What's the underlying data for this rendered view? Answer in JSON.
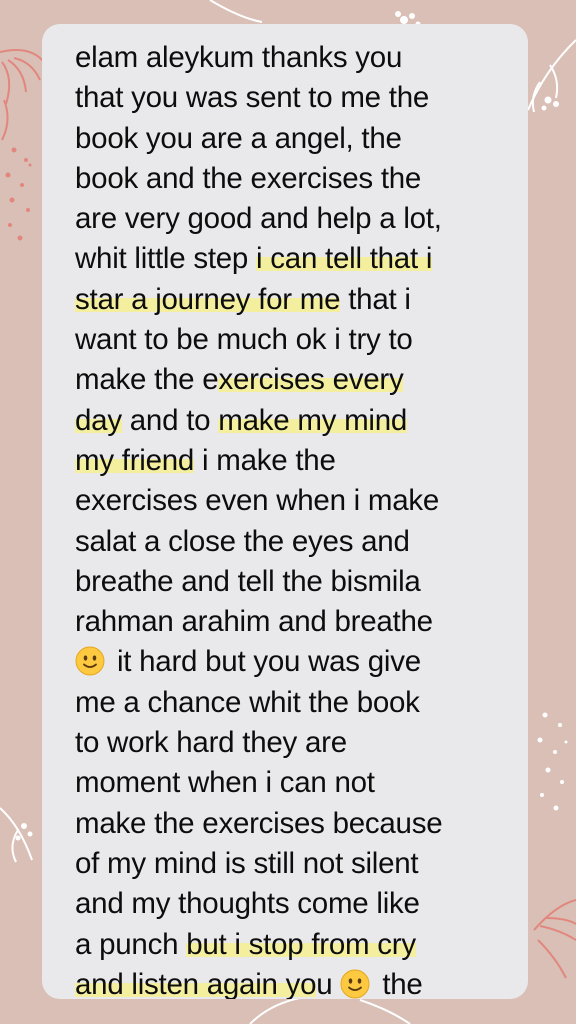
{
  "message": {
    "lines": [
      [
        {
          "t": "elam aleykum thanks you"
        }
      ],
      [
        {
          "t": "that you was sent to me the"
        }
      ],
      [
        {
          "t": "book you are a angel, the"
        }
      ],
      [
        {
          "t": "book and the exercises the"
        }
      ],
      [
        {
          "t": "are very good and help a lot,"
        }
      ],
      [
        {
          "t": "whit little step "
        },
        {
          "t": "i can tell that i",
          "hl": true
        }
      ],
      [
        {
          "t": "star a journey for me",
          "hl": true
        },
        {
          "t": " that i"
        }
      ],
      [
        {
          "t": "want to be much ok i try to"
        }
      ],
      [
        {
          "t": "make the e"
        },
        {
          "t": "xercises every",
          "hl": true
        }
      ],
      [
        {
          "t": "day",
          "hl": true
        },
        {
          "t": " and to "
        },
        {
          "t": "make my mind",
          "hl": true
        }
      ],
      [
        {
          "t": "my friend",
          "hl": true
        },
        {
          "t": " i make the"
        }
      ],
      [
        {
          "t": "exercises even when i make"
        }
      ],
      [
        {
          "t": "salat a close the eyes and"
        }
      ],
      [
        {
          "t": "breathe and tell the bismila"
        }
      ],
      [
        {
          "t": "rahman arahim and breathe"
        }
      ],
      [
        {
          "emoji": "slightly-smiling-face"
        },
        {
          "t": " it hard but you was give"
        }
      ],
      [
        {
          "t": "me a chance whit the book"
        }
      ],
      [
        {
          "t": "to work hard they are"
        }
      ],
      [
        {
          "t": "moment when i can not"
        }
      ],
      [
        {
          "t": "make the exercises because"
        }
      ],
      [
        {
          "t": "of my mind is still not silent"
        }
      ],
      [
        {
          "t": "and my thoughts come like"
        }
      ],
      [
        {
          "t": "a punch "
        },
        {
          "t": "but i stop from cry",
          "hl": true
        }
      ],
      [
        {
          "t": "and listen again yo",
          "hl": true
        },
        {
          "t": "u "
        },
        {
          "emoji": "slightly-smiling-face"
        },
        {
          "t": " the"
        }
      ]
    ]
  },
  "colors": {
    "background": "#d9bfb6",
    "bubble": "#e9e9eb",
    "highlight": "#f4ef9f",
    "text": "#0d0d0d",
    "decor_white": "#ffffff",
    "decor_coral": "#e2877e"
  }
}
